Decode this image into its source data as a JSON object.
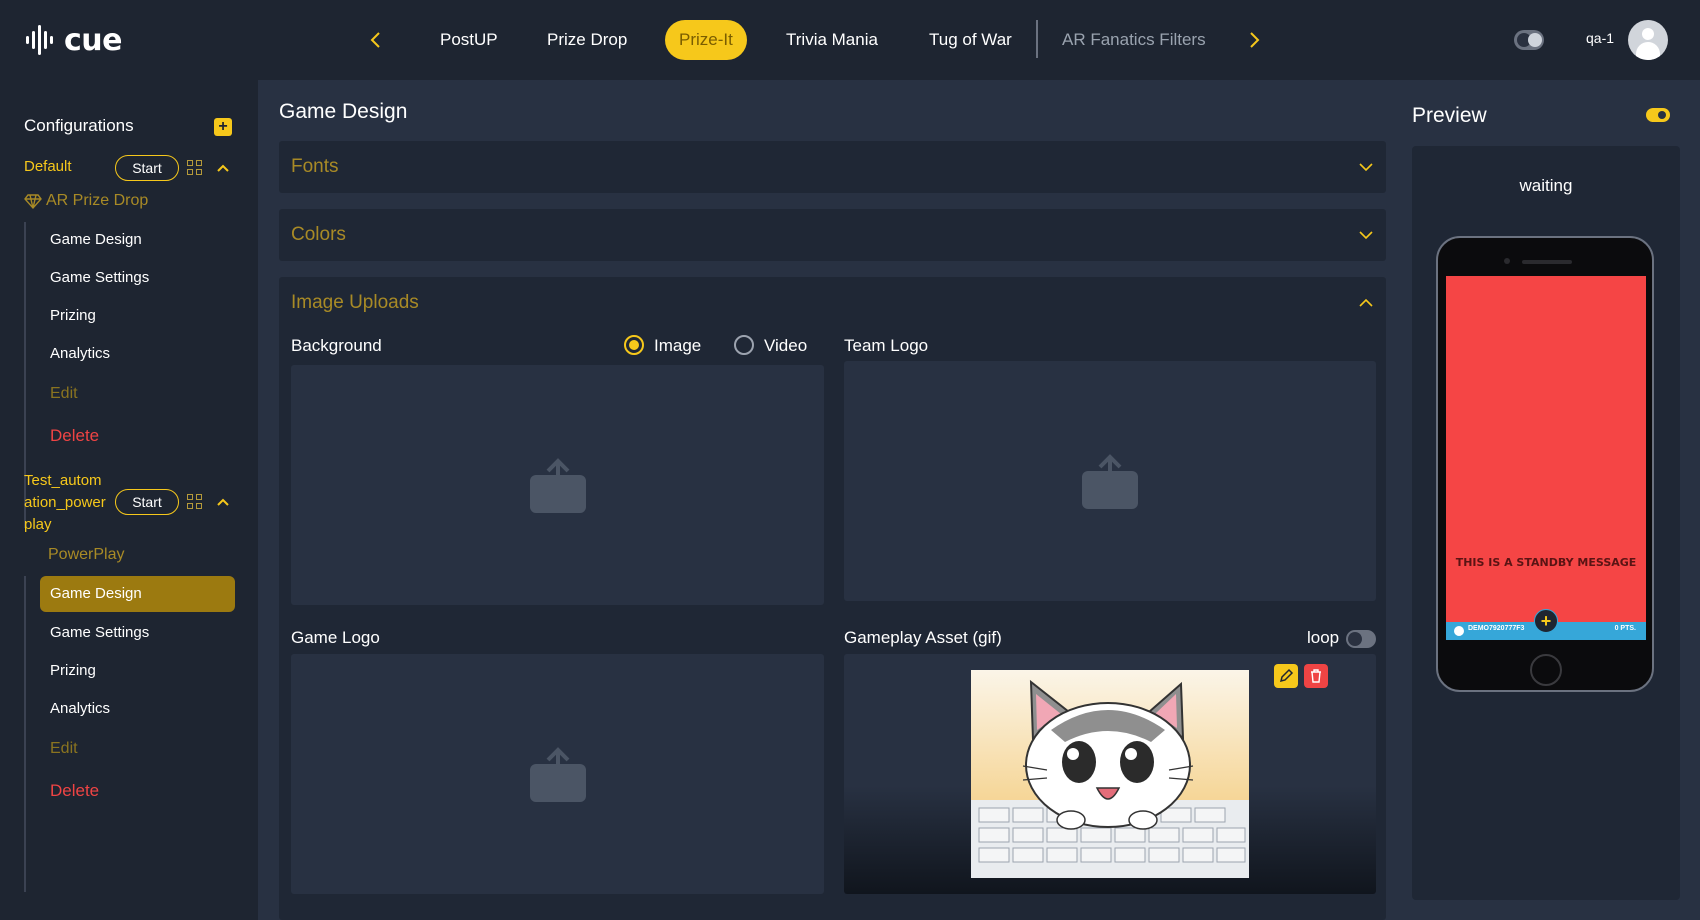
{
  "app": {
    "logo_text": "cue",
    "colors": {
      "accent": "#f6c81b",
      "background": "#1e2531",
      "panel": "#283142",
      "danger": "#ef4444"
    }
  },
  "nav": {
    "prev_icon": "chevron-left-icon",
    "next_icon": "chevron-right-icon",
    "tabs": [
      {
        "label": "PostUP"
      },
      {
        "label": "Prize Drop"
      },
      {
        "label": "Prize-It",
        "active": true
      },
      {
        "label": "Trivia Mania"
      },
      {
        "label": "Tug of War"
      },
      {
        "label": "AR Fanatics Filters"
      }
    ],
    "user": "qa-1"
  },
  "sidebar": {
    "title": "Configurations",
    "configs": [
      {
        "name": "Default",
        "start_label": "Start",
        "game": "AR Prize Drop",
        "items": [
          "Game Design",
          "Game Settings",
          "Prizing",
          "Analytics",
          "Edit",
          "Delete"
        ]
      },
      {
        "name_lines": [
          "Test_autom",
          "ation_power",
          "play"
        ],
        "start_label": "Start",
        "game": "PowerPlay",
        "items": [
          "Game Design",
          "Game Settings",
          "Prizing",
          "Analytics",
          "Edit",
          "Delete"
        ],
        "active_item": "Game Design"
      }
    ]
  },
  "main": {
    "title": "Game Design",
    "panels": {
      "fonts": "Fonts",
      "colors": "Colors",
      "image_uploads": "Image Uploads"
    },
    "uploads": {
      "background_label": "Background",
      "media_options": [
        "Image",
        "Video"
      ],
      "media_selected": "Image",
      "team_logo_label": "Team Logo",
      "game_logo_label": "Game Logo",
      "gameplay_asset_label": "Gameplay Asset (gif)",
      "loop_label": "loop",
      "loop_enabled": false
    }
  },
  "preview": {
    "title": "Preview",
    "enabled": true,
    "status": "waiting",
    "standby_message": "THIS IS A STANDBY MESSAGE",
    "bar_left": "DEMO7920777F3",
    "bar_right": "0 PTS.",
    "screen_color": "#f54545"
  }
}
